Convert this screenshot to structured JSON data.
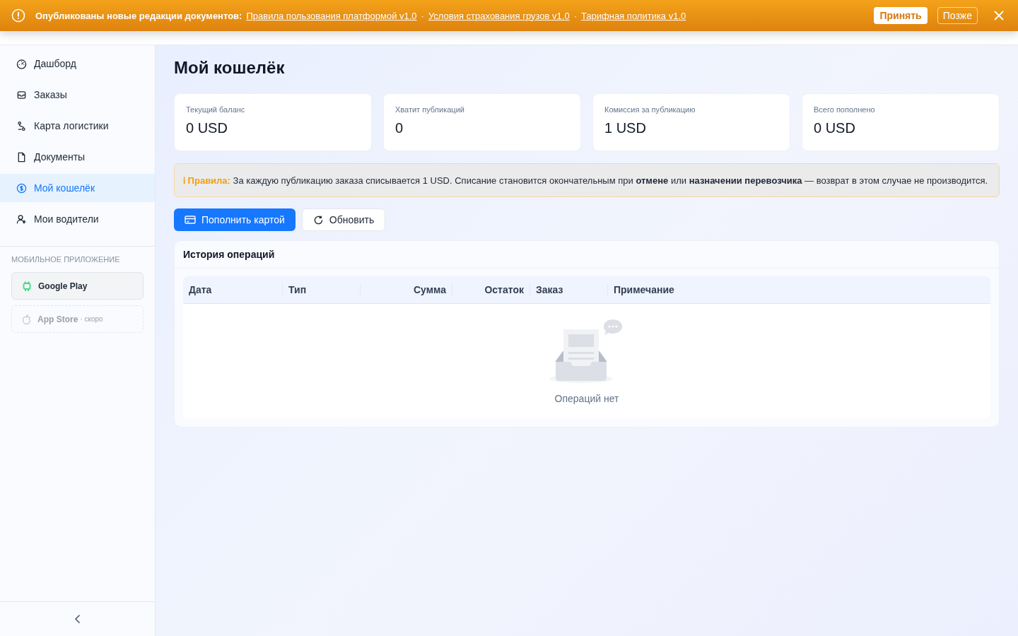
{
  "banner": {
    "message": "Опубликованы новые редакции документов:",
    "links": [
      "Правила пользования платформой v1.0",
      "Условия страхования грузов v1.0",
      "Тарифная политика v1.0"
    ],
    "separator": "·",
    "accept": "Принять",
    "later": "Позже"
  },
  "sidebar": {
    "items": [
      {
        "label": "Дашборд",
        "selected": false
      },
      {
        "label": "Заказы",
        "selected": false
      },
      {
        "label": "Карта логистики",
        "selected": false
      },
      {
        "label": "Документы",
        "selected": false
      },
      {
        "label": "Мой кошелёк",
        "selected": true
      },
      {
        "label": "Мои водители",
        "selected": false
      }
    ],
    "mobile_heading": "МОБИЛЬНОЕ ПРИЛОЖЕНИЕ",
    "apps": [
      {
        "label": "Google Play",
        "disabled": false
      },
      {
        "label": "App Store",
        "note": "· скоро",
        "disabled": true
      }
    ]
  },
  "page": {
    "title": "Мой кошелёк",
    "stats": [
      {
        "label": "Текущий баланс",
        "value": "0 USD"
      },
      {
        "label": "Хватит публикаций",
        "value": "0"
      },
      {
        "label": "Комиссия за публикацию",
        "value": "1 USD"
      },
      {
        "label": "Всего пополнено",
        "value": "0 USD"
      }
    ],
    "rules": {
      "icon": "ℹ",
      "label": "Правила:",
      "text": "За каждую публикацию заказа списывается 1 USD. Списание становится окончательным при **отмене** или **назначении перевозчика** — возврат в этом случае не производится."
    },
    "buttons": [
      {
        "label": "Пополнить картой",
        "kind": "primary"
      },
      {
        "label": "Обновить",
        "kind": "secondary"
      }
    ],
    "history": {
      "title": "История операций",
      "columns": [
        "Дата",
        "Тип",
        "Сумма",
        "Остаток",
        "Заказ",
        "Примечание"
      ],
      "empty": "Операций нет"
    }
  }
}
